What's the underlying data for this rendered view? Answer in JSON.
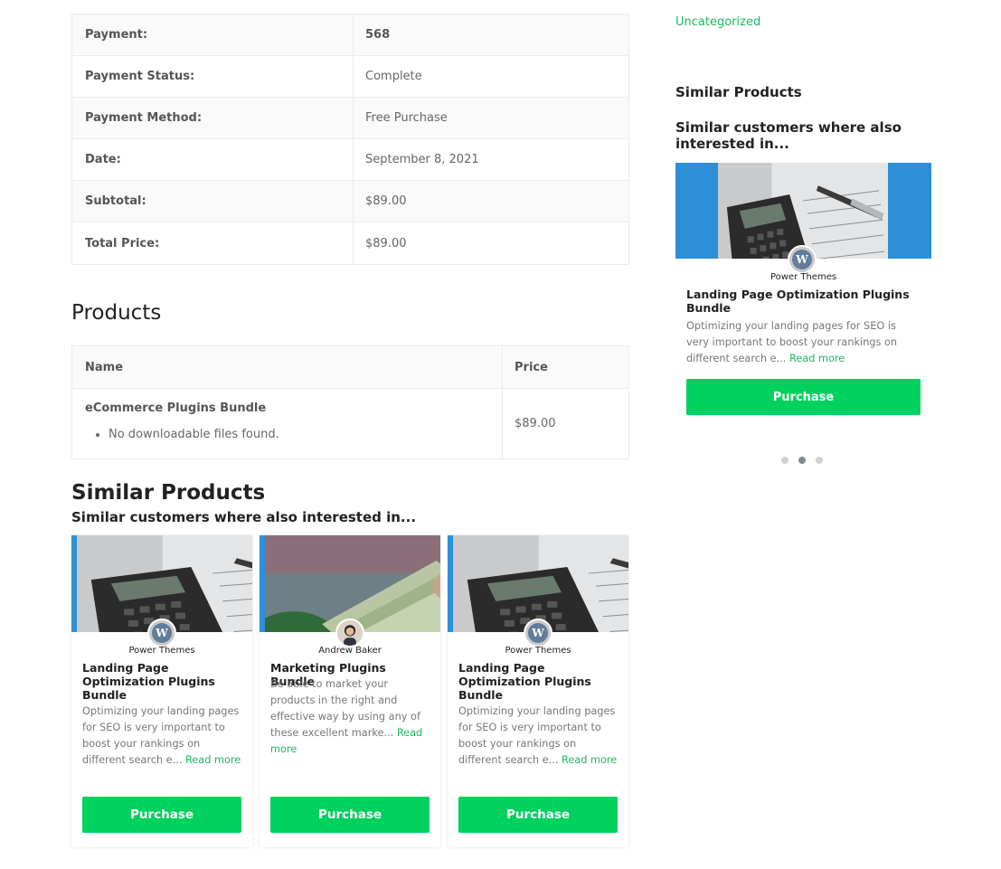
{
  "receipt": {
    "rows": [
      {
        "label": "Payment:",
        "value": "568"
      },
      {
        "label": "Payment Status:",
        "value": "Complete"
      },
      {
        "label": "Payment Method:",
        "value": "Free Purchase"
      },
      {
        "label": "Date:",
        "value": "September 8, 2021"
      },
      {
        "label": "Subtotal:",
        "value": "$89.00"
      },
      {
        "label": "Total Price:",
        "value": "$89.00"
      }
    ]
  },
  "products": {
    "title": "Products",
    "col_name": "Name",
    "col_price": "Price",
    "items": [
      {
        "name": "eCommerce Plugins Bundle",
        "files_note": "No downloadable files found.",
        "price": "$89.00"
      }
    ]
  },
  "similar": {
    "title": "Similar Products",
    "subtitle": "Similar customers where also interested in...",
    "cards": [
      {
        "author": "Power Themes",
        "title": "Landing Page Optimization Plugins Bundle",
        "desc": "Optimizing your landing pages for SEO is very important to boost your rankings on different search e...",
        "read_more": "Read more",
        "button": "Purchase",
        "image": "calculator-photo",
        "avatar": "wordpress-icon"
      },
      {
        "author": "Andrew Baker",
        "title": "Marketing Plugins Bundle",
        "desc": "Be able to market your products in the right and effective way by using any of these excellent marke...",
        "read_more": "Read more",
        "button": "Purchase",
        "image": "money-photo",
        "avatar": "person-avatar"
      },
      {
        "author": "Power Themes",
        "title": "Landing Page Optimization Plugins Bundle",
        "desc": "Optimizing your landing pages for SEO is very important to boost your rankings on different search e...",
        "read_more": "Read more",
        "button": "Purchase",
        "image": "calculator-photo",
        "avatar": "wordpress-icon"
      }
    ]
  },
  "sidebar": {
    "category": "Uncategorized",
    "title": "Similar Products",
    "subtitle": "Similar customers where also interested in...",
    "card": {
      "author": "Power Themes",
      "title": "Landing Page Optimization Plugins Bundle",
      "desc": "Optimizing your landing pages for SEO is very important to boost your rankings on different search e...",
      "read_more": "Read more",
      "button": "Purchase"
    },
    "carousel": {
      "total": 3,
      "active": 2
    }
  },
  "colors": {
    "accent": "#00d15f",
    "link": "#1cb862",
    "image_border": "#2d8fd8"
  }
}
